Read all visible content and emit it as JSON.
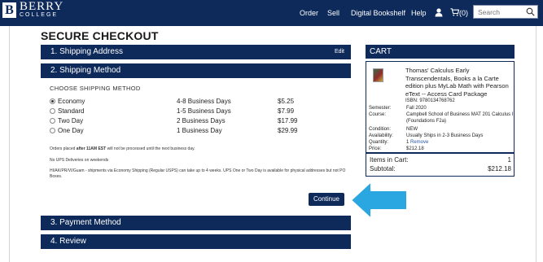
{
  "header": {
    "logo_letter": "B",
    "logo_name": "BERRY",
    "logo_sub": "COLLEGE",
    "nav": [
      "Order",
      "Sell",
      "Digital Bookshelf",
      "Help"
    ],
    "cart_count": "(0)",
    "search_placeholder": "Search",
    "icons": [
      "user-icon",
      "cart-icon",
      "search-icon"
    ],
    "colors": {
      "nav_bg": "#0d2a5a",
      "arrow": "#2aa7e0"
    }
  },
  "checkout": {
    "title": "SECURE CHECKOUT",
    "sections": [
      {
        "label": "1. Shipping Address",
        "action": "Edit"
      },
      {
        "label": "2. Shipping Method"
      },
      {
        "label": "3. Payment Method"
      },
      {
        "label": "4. Review"
      }
    ],
    "choose_label": "CHOOSE SHIPPING METHOD",
    "options": [
      {
        "name": "Economy",
        "days": "4-8 Business Days",
        "price": "$5.25",
        "selected": true
      },
      {
        "name": "Standard",
        "days": "1-5 Business Days",
        "price": "$7.99",
        "selected": false
      },
      {
        "name": "Two Day",
        "days": "2 Business Days",
        "price": "$17.99",
        "selected": false
      },
      {
        "name": "One Day",
        "days": "1 Business Day",
        "price": "$29.99",
        "selected": false
      }
    ],
    "notes": {
      "n1_pre": "Orders placed ",
      "n1_bold": "after 11AM EST",
      "n1_post": " will not be processed until the next business day.",
      "n2": "No UPS Deliveries on weekends",
      "n3": "HI/AK/PR/VI/Guam - shipments via Economy Shipping (Regular USPS) can take up to 4 weeks. UPS One or Two Day is available for physical addresses but not PO Boxes."
    },
    "continue_label": "Continue"
  },
  "cart": {
    "title": "CART",
    "item_title": "Thomas' Calculus Early Transcendentals, Books a la Carte edition plus MyLab Math with Pearson eText -- Access Card Package",
    "isbn": "ISBN: 9780134768762",
    "meta": [
      {
        "k": "Semester:",
        "v": "Fall 2020"
      },
      {
        "k": "Course:",
        "v": "Campbell School of Business MAT 201 Calculus I (Foundations F2a)"
      },
      {
        "k": "Condition:",
        "v": "NEW"
      },
      {
        "k": "Availability:",
        "v": "Usually Ships in 2-3 Business Days"
      },
      {
        "k": "Quantity:",
        "v": "1"
      },
      {
        "k": "Price:",
        "v": "$212.18"
      }
    ],
    "remove_label": "Remove",
    "items_label": "Items in Cart:",
    "items_count": "1",
    "subtotal_label": "Subtotal:",
    "subtotal_value": "$212.18"
  }
}
